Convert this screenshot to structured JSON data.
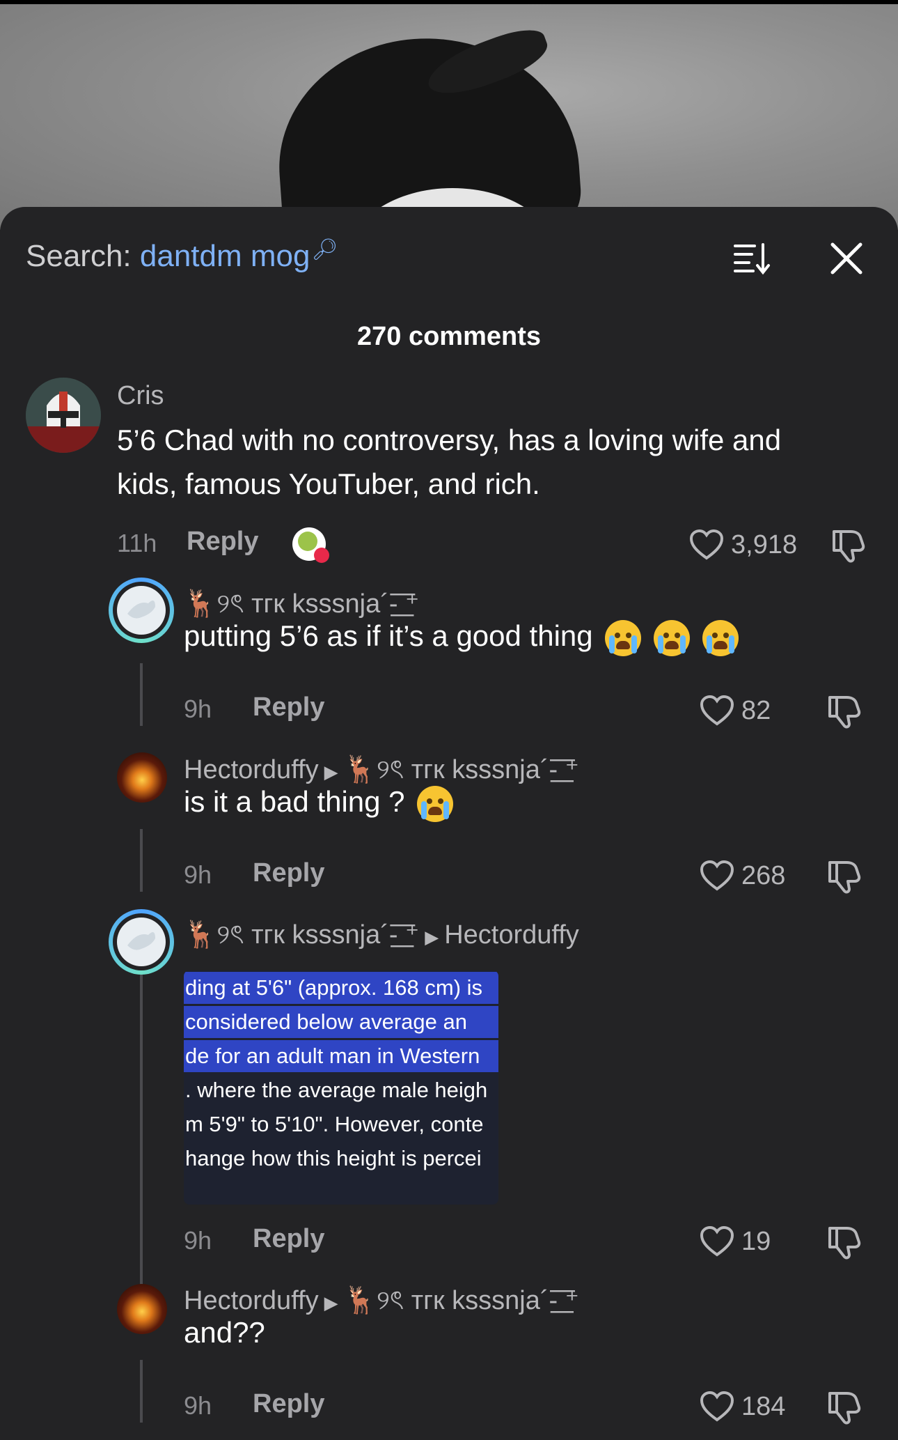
{
  "search": {
    "prefix": "Search:",
    "term": "dantdm mog"
  },
  "comments_count": "270 comments",
  "comments": [
    {
      "username": "Cris",
      "text_line1": "5’6 Chad with no controversy, has a loving wife and",
      "text_line2": "kids, famous YouTuber, and rich.",
      "time": "11h",
      "reply_label": "Reply",
      "likes": "3,918"
    },
    {
      "username": "🦌୨ৎ тгк ksssnja´-͟͟͞͞ ⁺",
      "text": "putting 5’6 as if it’s a good thing",
      "time": "9h",
      "reply_label": "Reply",
      "likes": "82"
    },
    {
      "username": "Hectorduffy",
      "reply_to": "🦌୨ৎ тгк ksssnja´-͟͟͞͞ ⁺",
      "text": "is it a bad thing ?",
      "time": "9h",
      "reply_label": "Reply",
      "likes": "268"
    },
    {
      "username": "🦌୨ৎ тгк ksssnja´-͟͟͞͞ ⁺",
      "reply_to": "Hectorduffy",
      "screenshot_lines": [
        "ding at 5'6\" (approx. 168 cm) is",
        "considered below average an",
        "de for an adult man in Western",
        ". where the average male heigh",
        "m 5'9\" to 5'10\". However, conte",
        "hange how this height is percei"
      ],
      "time": "9h",
      "reply_label": "Reply",
      "likes": "19"
    },
    {
      "username": "Hectorduffy",
      "reply_to": "🦌୨ৎ тгк ksssnja´-͟͟͞͞ ⁺",
      "text": "and??",
      "time": "9h",
      "reply_label": "Reply",
      "likes": "184"
    }
  ],
  "colors": {
    "background": "#232325",
    "search_term": "#7fb1f5",
    "highlight": "#2f45c4"
  }
}
